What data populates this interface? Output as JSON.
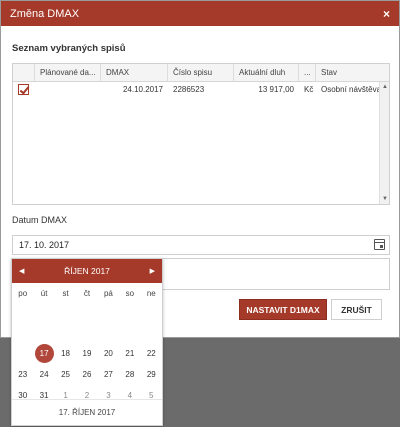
{
  "dialog": {
    "title": "Změna DMAX",
    "close_symbol": "×"
  },
  "section": {
    "title": "Seznam vybraných spisů"
  },
  "grid": {
    "columns": [
      "",
      "Plánované da...",
      "DMAX",
      "Číslo spisu",
      "Aktuální dluh",
      "...",
      "Stav"
    ],
    "rows": [
      {
        "checked": true,
        "planned": "",
        "dmax": "24.10.2017",
        "case_no": "2286523",
        "debt": "13 917,00",
        "currency": "Kč",
        "state": "Osobní návštěva"
      }
    ]
  },
  "date_field": {
    "label": "Datum DMAX",
    "value": "17. 10. 2017"
  },
  "buttons": {
    "set": "NASTAVIT D1MAX",
    "cancel": "ZRUŠIT"
  },
  "calendar": {
    "month_label": "ŘÍJEN 2017",
    "prev_symbol": "◀",
    "next_symbol": "▶",
    "weekdays": [
      "po",
      "út",
      "st",
      "čt",
      "pá",
      "so",
      "ne"
    ],
    "weeks": [
      [
        {
          "d": "",
          "hidden": true
        },
        {
          "d": "",
          "hidden": true
        },
        {
          "d": "",
          "hidden": true
        },
        {
          "d": "",
          "hidden": true
        },
        {
          "d": "",
          "hidden": true
        },
        {
          "d": "",
          "hidden": true
        },
        {
          "d": "",
          "hidden": true
        }
      ],
      [
        {
          "d": "",
          "hidden": true
        },
        {
          "d": "",
          "hidden": true
        },
        {
          "d": "",
          "hidden": true
        },
        {
          "d": "",
          "hidden": true
        },
        {
          "d": "",
          "hidden": true
        },
        {
          "d": "",
          "hidden": true
        },
        {
          "d": "",
          "hidden": true
        }
      ],
      [
        {
          "d": "",
          "hidden": true
        },
        {
          "d": "17",
          "selected": true
        },
        {
          "d": "18"
        },
        {
          "d": "19"
        },
        {
          "d": "20"
        },
        {
          "d": "21"
        },
        {
          "d": "22"
        }
      ],
      [
        {
          "d": "23"
        },
        {
          "d": "24"
        },
        {
          "d": "25"
        },
        {
          "d": "26"
        },
        {
          "d": "27"
        },
        {
          "d": "28"
        },
        {
          "d": "29"
        }
      ],
      [
        {
          "d": "30"
        },
        {
          "d": "31"
        },
        {
          "d": "1",
          "other": true
        },
        {
          "d": "2",
          "other": true
        },
        {
          "d": "3",
          "other": true
        },
        {
          "d": "4",
          "other": true
        },
        {
          "d": "5",
          "other": true
        }
      ],
      [
        {
          "d": "",
          "hidden": true
        },
        {
          "d": "",
          "hidden": true
        },
        {
          "d": "",
          "hidden": true
        },
        {
          "d": "",
          "hidden": true
        },
        {
          "d": "",
          "hidden": true
        },
        {
          "d": "",
          "hidden": true
        },
        {
          "d": "",
          "hidden": true
        }
      ]
    ],
    "footer": "17. ŘÍJEN 2017"
  },
  "colors": {
    "accent": "#a53a2a",
    "selected_day": "#b0473a",
    "backdrop": "#6b6b6b"
  }
}
